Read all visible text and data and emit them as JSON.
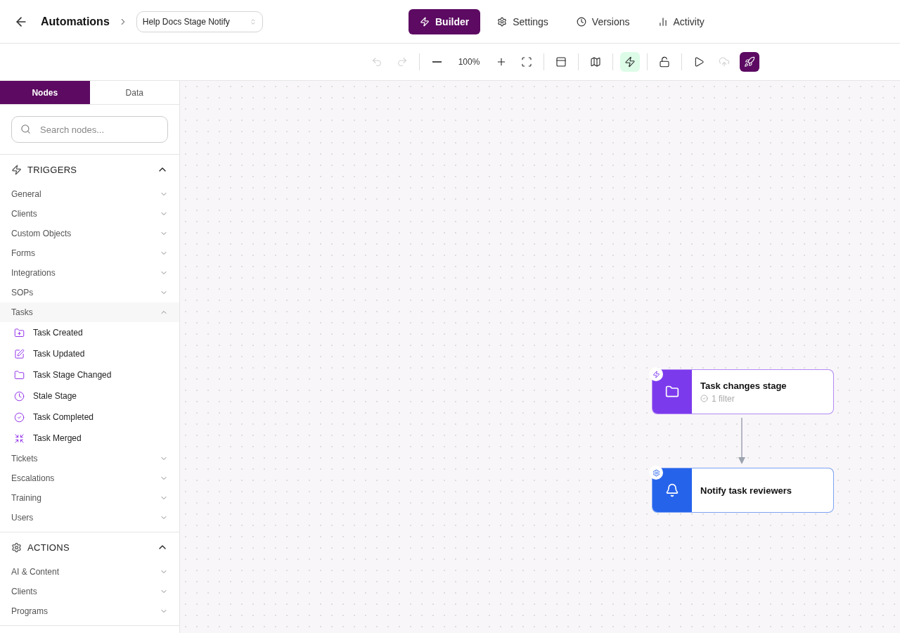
{
  "header": {
    "title": "Automations",
    "workflow": "Help Docs Stage Notify",
    "tabs": [
      {
        "label": "Builder",
        "selected": true
      },
      {
        "label": "Settings",
        "selected": false
      },
      {
        "label": "Versions",
        "selected": false
      },
      {
        "label": "Activity",
        "selected": false
      }
    ]
  },
  "toolbar": {
    "items": [
      {
        "kind": "undo",
        "disabled": true
      },
      {
        "kind": "redo",
        "disabled": true
      },
      {
        "kind": "divider"
      },
      {
        "kind": "zoom-out",
        "disabled": false
      },
      {
        "kind": "zoom",
        "text": "100%"
      },
      {
        "kind": "zoom-in",
        "disabled": false
      },
      {
        "kind": "fit",
        "disabled": false
      },
      {
        "kind": "divider"
      },
      {
        "kind": "panel",
        "disabled": false
      },
      {
        "kind": "divider"
      },
      {
        "kind": "map",
        "disabled": false
      },
      {
        "kind": "divider"
      },
      {
        "kind": "bolt",
        "active": true
      },
      {
        "kind": "divider"
      },
      {
        "kind": "lock",
        "disabled": false
      },
      {
        "kind": "divider"
      },
      {
        "kind": "play",
        "disabled": false
      },
      {
        "kind": "upload",
        "disabled": true
      },
      {
        "kind": "rocket",
        "primary": true
      }
    ]
  },
  "sidebar": {
    "tabs": [
      {
        "label": "Nodes",
        "selected": true
      },
      {
        "label": "Data",
        "selected": false
      }
    ],
    "search": {
      "placeholder": "Search nodes..."
    },
    "sections": [
      {
        "kind": "triggers",
        "title": "TRIGGERS",
        "expanded": true,
        "groups": [
          {
            "label": "General",
            "expanded": false
          },
          {
            "label": "Clients",
            "expanded": false
          },
          {
            "label": "Custom Objects",
            "expanded": false
          },
          {
            "label": "Forms",
            "expanded": false
          },
          {
            "label": "Integrations",
            "expanded": false
          },
          {
            "label": "SOPs",
            "expanded": false
          },
          {
            "label": "Tasks",
            "expanded": true,
            "children": [
              {
                "label": "Task Created"
              },
              {
                "label": "Task Updated"
              },
              {
                "label": "Task Stage Changed"
              },
              {
                "label": "Stale Stage"
              },
              {
                "label": "Task Completed"
              },
              {
                "label": "Task Merged"
              }
            ]
          },
          {
            "label": "Tickets",
            "expanded": false
          },
          {
            "label": "Escalations",
            "expanded": false
          },
          {
            "label": "Training",
            "expanded": false
          },
          {
            "label": "Users",
            "expanded": false
          }
        ]
      },
      {
        "kind": "actions",
        "title": "ACTIONS",
        "expanded": true,
        "groups": [
          {
            "label": "AI & Content",
            "expanded": false
          },
          {
            "label": "Clients",
            "expanded": false
          },
          {
            "label": "Programs",
            "expanded": false
          }
        ]
      }
    ]
  },
  "canvas": {
    "nodes": [
      {
        "kind": "trigger",
        "title": "Task changes stage",
        "subtitle": "1 filter",
        "color": "#7c3aed"
      },
      {
        "kind": "action",
        "title": "Notify task reviewers",
        "color": "#2563eb"
      }
    ]
  }
}
